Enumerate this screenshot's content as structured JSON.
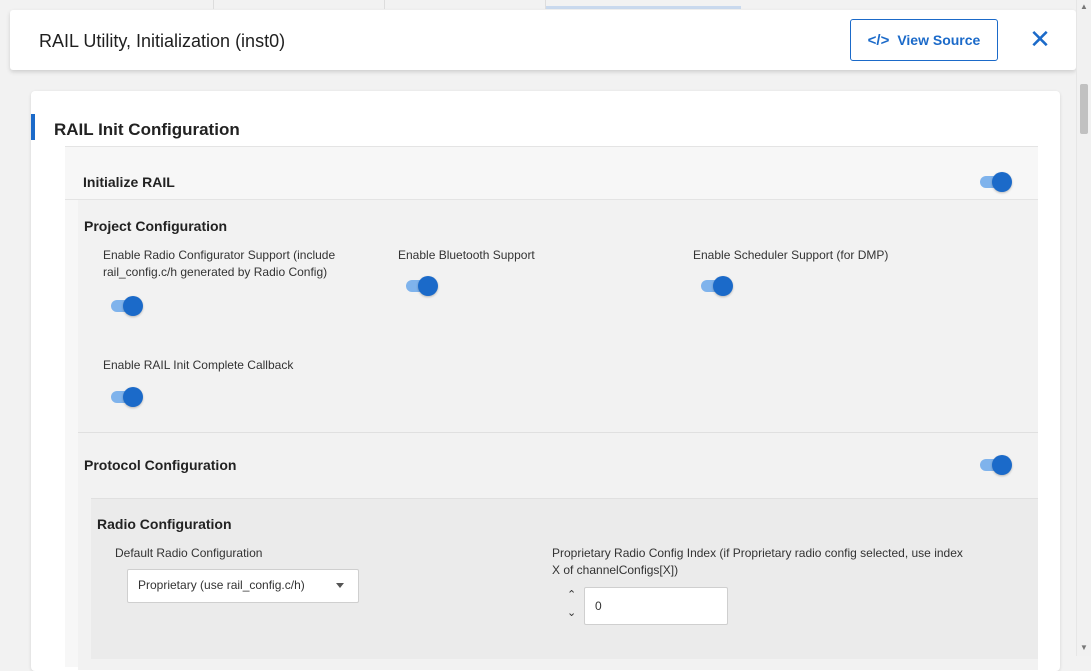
{
  "header": {
    "title": "RAIL Utility, Initialization (inst0)",
    "view_source_label": "View Source",
    "close_symbol": "✕"
  },
  "section": {
    "title": "RAIL Init Configuration"
  },
  "init_rail": {
    "label": "Initialize RAIL",
    "enabled": true
  },
  "project_config": {
    "title": "Project Configuration",
    "options": [
      {
        "label": "Enable Radio Configurator Support (include rail_config.c/h generated by Radio Config)",
        "enabled": true
      },
      {
        "label": "Enable Bluetooth Support",
        "enabled": true
      },
      {
        "label": "Enable Scheduler Support (for DMP)",
        "enabled": true
      },
      {
        "label": "Enable RAIL Init Complete Callback",
        "enabled": true
      }
    ]
  },
  "protocol_config": {
    "title": "Protocol Configuration",
    "enabled": true
  },
  "radio_config": {
    "title": "Radio Configuration",
    "default_label": "Default Radio Configuration",
    "default_value": "Proprietary (use rail_config.c/h)",
    "index_label": "Proprietary Radio Config Index (if Proprietary radio config selected, use index X of channelConfigs[X])",
    "index_value": "0"
  },
  "colors": {
    "accent": "#1b6ac9",
    "toggle_track": "#7fb3ec"
  }
}
